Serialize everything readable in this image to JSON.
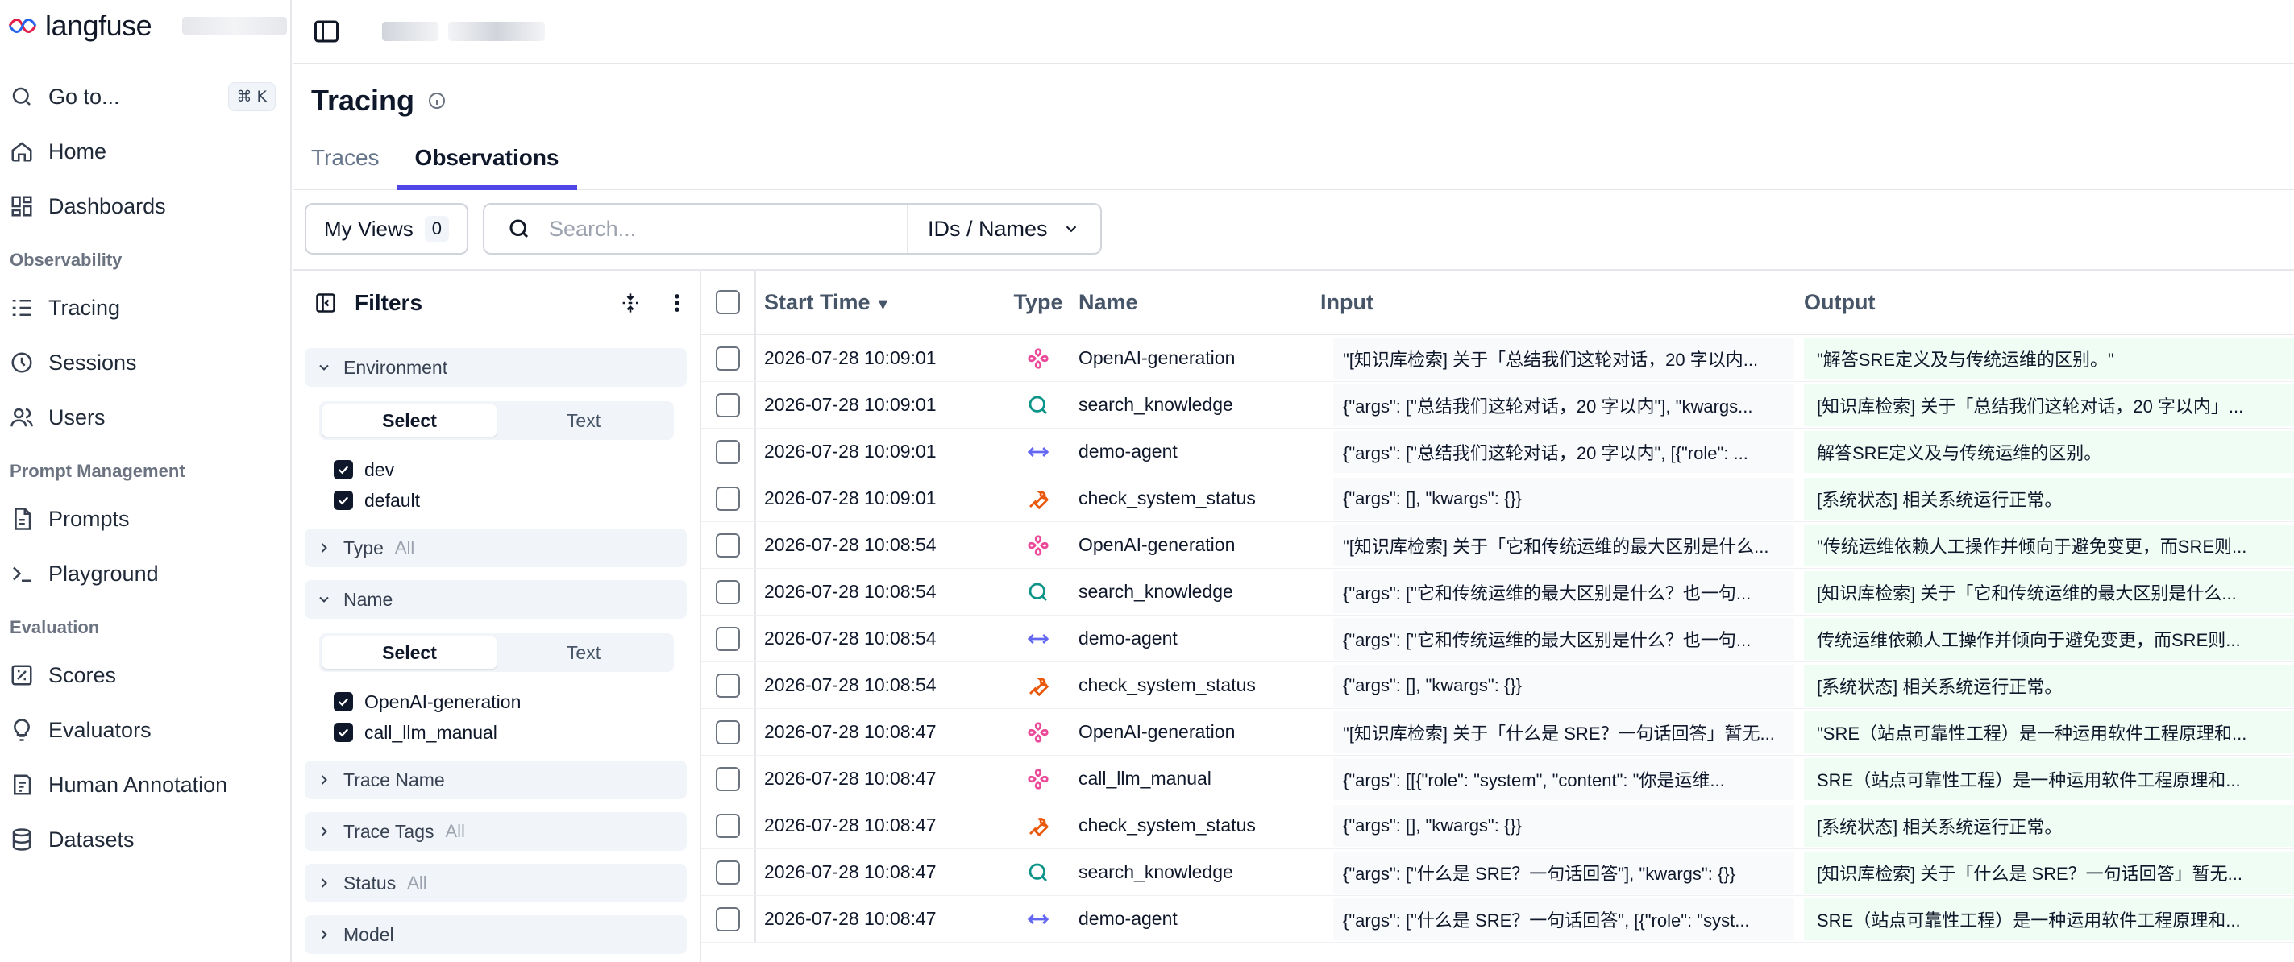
{
  "brand": {
    "name": "langfuse"
  },
  "nav": {
    "goto": "Go to...",
    "goto_kbd": "⌘ K",
    "home": "Home",
    "dashboards": "Dashboards",
    "section_observability": "Observability",
    "tracing": "Tracing",
    "sessions": "Sessions",
    "users": "Users",
    "section_prompt": "Prompt Management",
    "prompts": "Prompts",
    "playground": "Playground",
    "section_evaluation": "Evaluation",
    "scores": "Scores",
    "evaluators": "Evaluators",
    "human_annotation": "Human Annotation",
    "datasets": "Datasets"
  },
  "page": {
    "title": "Tracing",
    "tabs": [
      "Traces",
      "Observations"
    ],
    "active_tab": "Observations"
  },
  "toolbar": {
    "my_views": "My Views",
    "views_count": "0",
    "search_placeholder": "Search...",
    "id_select": "IDs / Names"
  },
  "filters": {
    "title": "Filters",
    "environment": {
      "label": "Environment",
      "seg": [
        "Select",
        "Text"
      ],
      "options": [
        "dev",
        "default"
      ]
    },
    "type": {
      "label": "Type",
      "value": "All"
    },
    "name": {
      "label": "Name",
      "seg": [
        "Select",
        "Text"
      ],
      "options": [
        "OpenAI-generation",
        "call_llm_manual"
      ]
    },
    "trace_name": {
      "label": "Trace Name"
    },
    "trace_tags": {
      "label": "Trace Tags",
      "value": "All"
    },
    "status": {
      "label": "Status",
      "value": "All"
    },
    "model": {
      "label": "Model"
    }
  },
  "table": {
    "headers": {
      "start_time": "Start Time",
      "type": "Type",
      "name": "Name",
      "input": "Input",
      "output": "Output"
    },
    "rows": [
      {
        "time": "2026-07-28 10:09:01",
        "type": "generation",
        "name": "OpenAI-generation",
        "input": "\"[知识库检索] 关于「总结我们这轮对话，20 字以内...",
        "output": "\"解答SRE定义及与传统运维的区别。\""
      },
      {
        "time": "2026-07-28 10:09:01",
        "type": "retriever",
        "name": "search_knowledge",
        "input": "{\"args\": [\"总结我们这轮对话，20 字以内\"], \"kwargs...",
        "output": "[知识库检索] 关于「总结我们这轮对话，20 字以内」..."
      },
      {
        "time": "2026-07-28 10:09:01",
        "type": "agent",
        "name": "demo-agent",
        "input": "{\"args\": [\"总结我们这轮对话，20 字以内\", [{\"role\": ...",
        "output": "解答SRE定义及与传统运维的区别。"
      },
      {
        "time": "2026-07-28 10:09:01",
        "type": "tool",
        "name": "check_system_status",
        "input": "{\"args\": [], \"kwargs\": {}}",
        "output": "[系统状态] 相关系统运行正常。"
      },
      {
        "time": "2026-07-28 10:08:54",
        "type": "generation",
        "name": "OpenAI-generation",
        "input": "\"[知识库检索] 关于「它和传统运维的最大区别是什么...",
        "output": "\"传统运维依赖人工操作并倾向于避免变更，而SRE则..."
      },
      {
        "time": "2026-07-28 10:08:54",
        "type": "retriever",
        "name": "search_knowledge",
        "input": "{\"args\": [\"它和传统运维的最大区别是什么？也一句...",
        "output": "[知识库检索] 关于「它和传统运维的最大区别是什么..."
      },
      {
        "time": "2026-07-28 10:08:54",
        "type": "agent",
        "name": "demo-agent",
        "input": "{\"args\": [\"它和传统运维的最大区别是什么？也一句...",
        "output": "传统运维依赖人工操作并倾向于避免变更，而SRE则..."
      },
      {
        "time": "2026-07-28 10:08:54",
        "type": "tool",
        "name": "check_system_status",
        "input": "{\"args\": [], \"kwargs\": {}}",
        "output": "[系统状态] 相关系统运行正常。"
      },
      {
        "time": "2026-07-28 10:08:47",
        "type": "generation",
        "name": "OpenAI-generation",
        "input": "\"[知识库检索] 关于「什么是 SRE？一句话回答」暂无...",
        "output": "\"SRE（站点可靠性工程）是一种运用软件工程原理和..."
      },
      {
        "time": "2026-07-28 10:08:47",
        "type": "generation",
        "name": "call_llm_manual",
        "input": "{\"args\": [[{\"role\": \"system\", \"content\": \"你是运维...",
        "output": "SRE（站点可靠性工程）是一种运用软件工程原理和..."
      },
      {
        "time": "2026-07-28 10:08:47",
        "type": "tool",
        "name": "check_system_status",
        "input": "{\"args\": [], \"kwargs\": {}}",
        "output": "[系统状态] 相关系统运行正常。"
      },
      {
        "time": "2026-07-28 10:08:47",
        "type": "retriever",
        "name": "search_knowledge",
        "input": "{\"args\": [\"什么是 SRE？一句话回答\"], \"kwargs\": {}}",
        "output": "[知识库检索] 关于「什么是 SRE？一句话回答」暂无..."
      },
      {
        "time": "2026-07-28 10:08:47",
        "type": "agent",
        "name": "demo-agent",
        "input": "{\"args\": [\"什么是 SRE？一句话回答\", [{\"role\": \"syst...",
        "output": "SRE（站点可靠性工程）是一种运用软件工程原理和..."
      }
    ]
  },
  "colors": {
    "accent": "#4f46e5",
    "generation": "#ec4899",
    "retriever": "#0d9488",
    "agent": "#6366f1",
    "tool": "#ea580c"
  }
}
